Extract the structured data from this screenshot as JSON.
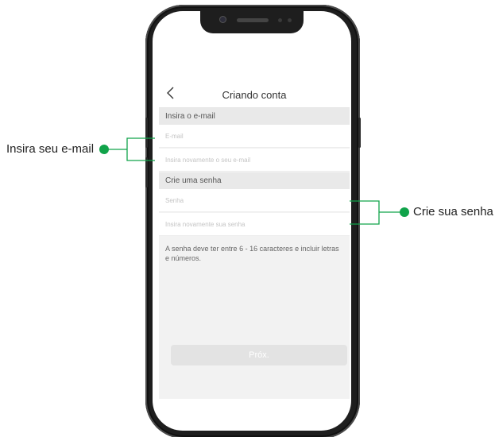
{
  "app": {
    "title": "Criando conta",
    "back_icon": "chevron-left-icon",
    "email_section": {
      "header": "Insira o e-mail",
      "email_placeholder": "E-mail",
      "email_confirm_placeholder": "Insira novamente o seu e-mail"
    },
    "password_section": {
      "header": "Crie uma senha",
      "password_placeholder": "Senha",
      "password_confirm_placeholder": "Insira novamente sua senha"
    },
    "hint": "A senha deve ter entre 6 - 16 caracteres e incluir letras e números.",
    "next_label": "Próx."
  },
  "annotations": {
    "email_callout": "Insira seu e-mail",
    "password_callout": "Crie sua senha",
    "accent_color": "#10a34a"
  }
}
